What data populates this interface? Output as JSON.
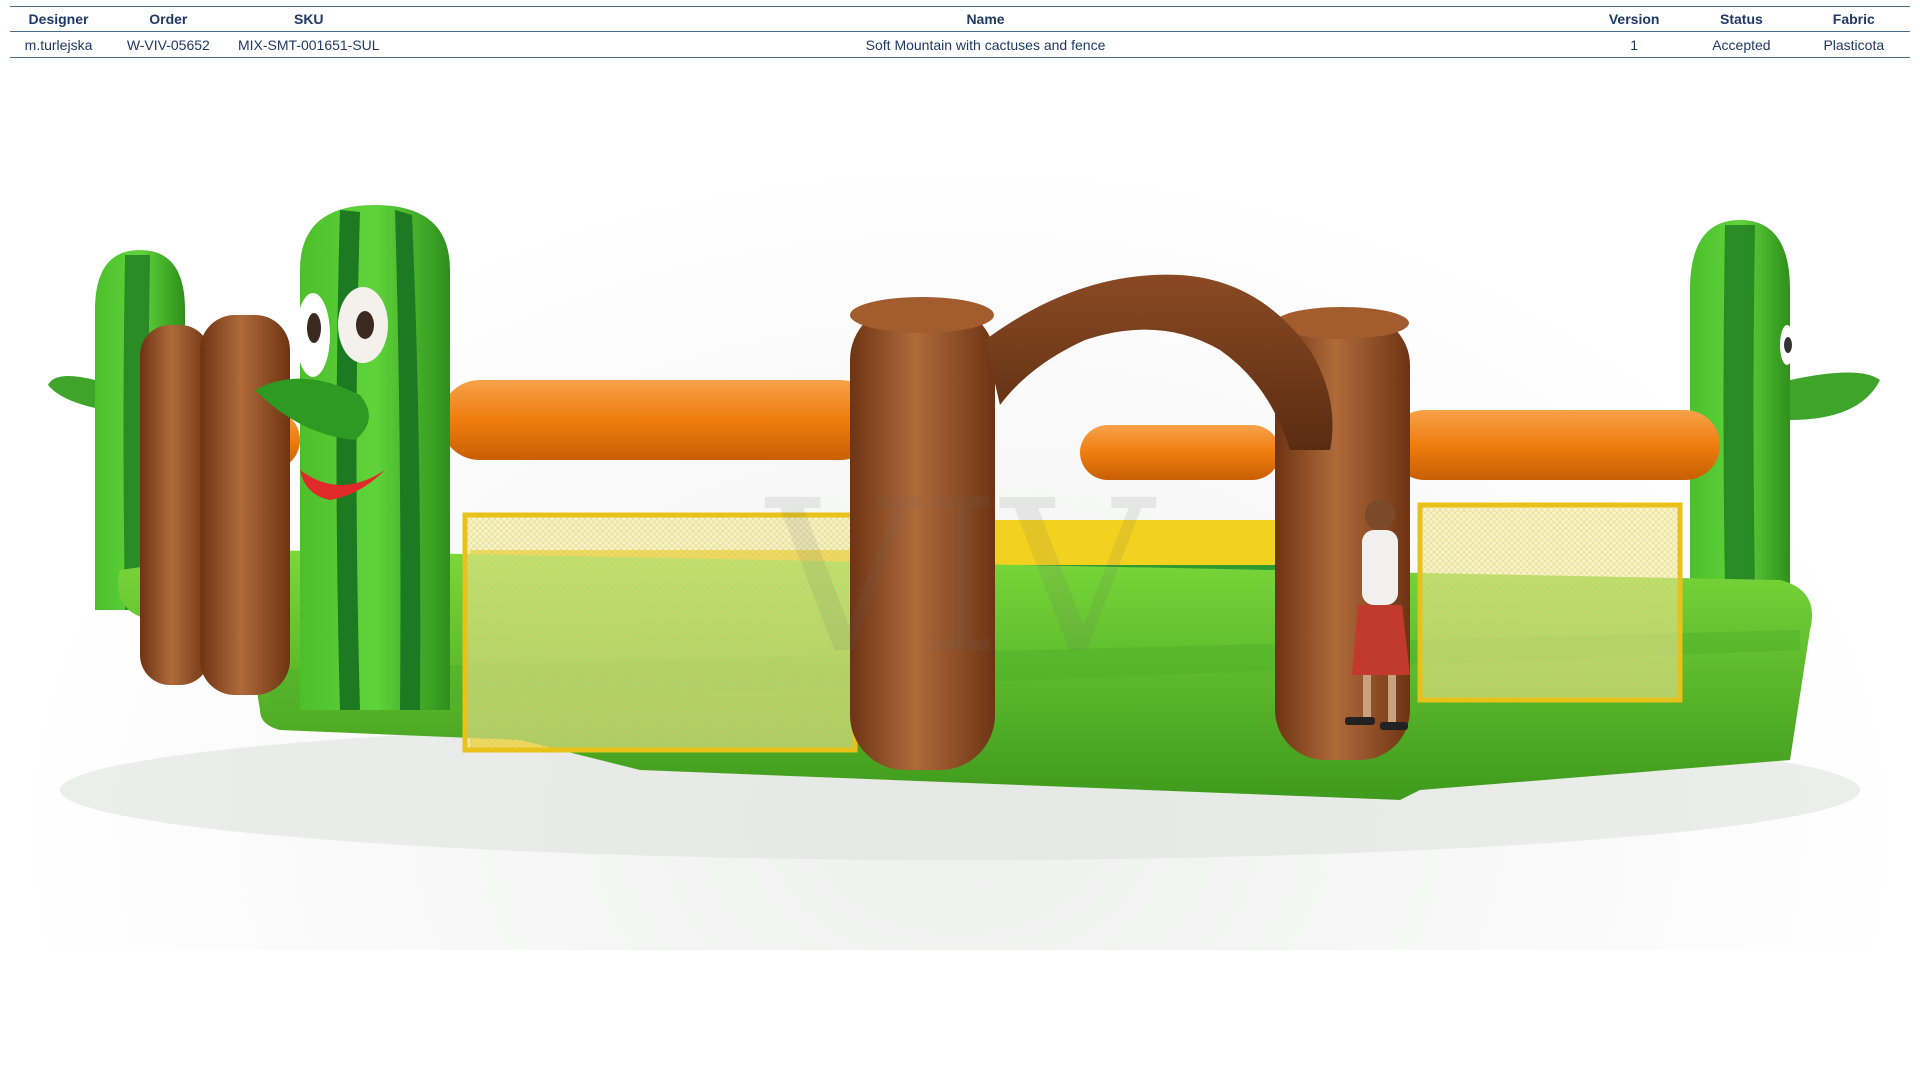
{
  "spec_table": {
    "headers": [
      "Designer",
      "Order",
      "SKU",
      "Name",
      "Version",
      "Status",
      "Fabric"
    ],
    "row": [
      "m.turlejska",
      "W-VIV-05652",
      "MIX-SMT-001651-SUL",
      "Soft Mountain with cactuses and fence",
      "1",
      "Accepted",
      "Plasticota"
    ]
  },
  "colors": {
    "header_text": "#1f3864",
    "cactus_green": "#3fa52a",
    "cactus_stripe": "#1e7a22",
    "base_green": "#63c62b",
    "fence_orange": "#ef7d0e",
    "log_brown": "#8a4a23",
    "arch_brown": "#6b3519",
    "net_yellow": "#e8c21a"
  },
  "watermark": "VIV"
}
